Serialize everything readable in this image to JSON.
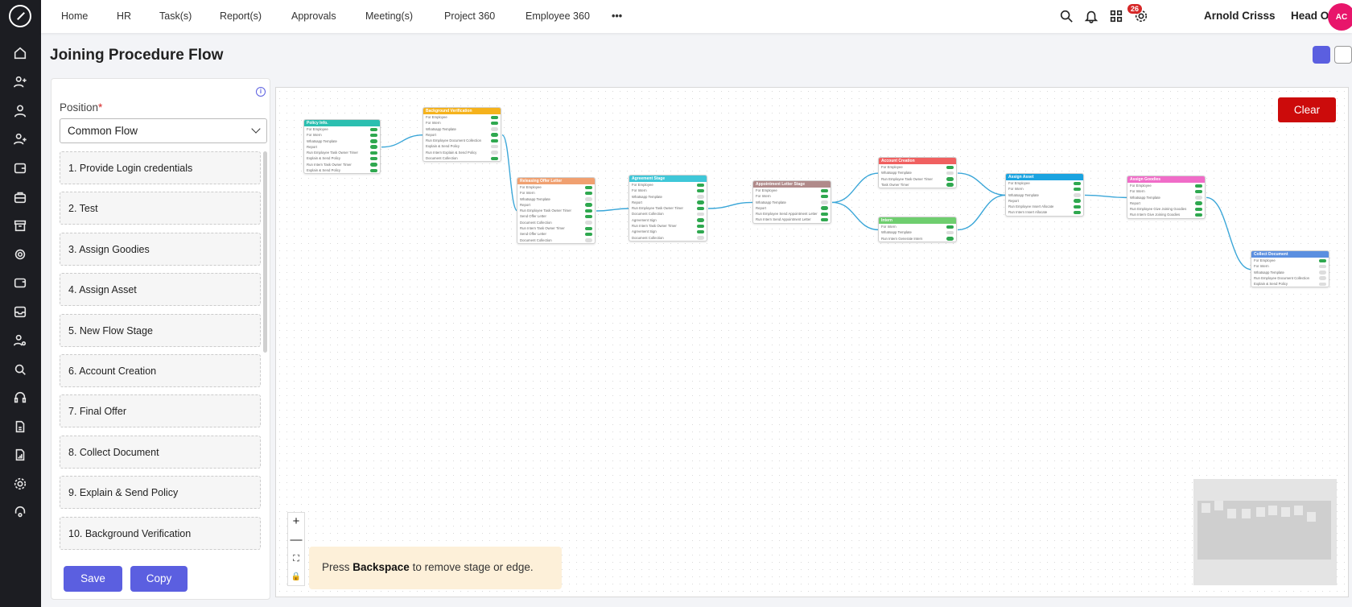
{
  "app": {
    "title": "Joining Procedure Flow"
  },
  "nav": [
    "Home",
    "HR",
    "Task(s)",
    "Report(s)",
    "Approvals",
    "Meeting(s)",
    "Project 360",
    "Employee 360",
    "•••"
  ],
  "header": {
    "notifications_count": "26",
    "user_name": "Arnold Crisss",
    "office": "Head Office",
    "avatar_initials": "AC"
  },
  "position": {
    "label": "Position",
    "required_mark": "*",
    "selected": "Common Flow"
  },
  "stages": [
    "1. Provide Login credentials",
    "2. Test",
    "3. Assign Goodies",
    "4. Assign Asset",
    "5. New Flow Stage",
    "6. Account Creation",
    "7. Final Offer",
    "8. Collect Document",
    "9. Explain & Send Policy",
    "10. Background Verification"
  ],
  "buttons": {
    "save": "Save",
    "copy": "Copy",
    "clear": "Clear"
  },
  "zoom": {
    "in": "+",
    "out": "—",
    "fit": "⛶",
    "lock": "🔒"
  },
  "hint": {
    "prefix": "Press ",
    "key": "Backspace",
    "suffix": " to remove stage or edge."
  },
  "colors": {
    "accent": "#5b5fe0",
    "danger": "#cc0b0b",
    "toggle_on": "#2fa84f",
    "edge": "#3aa6d8"
  },
  "flow_nodes": [
    {
      "id": "policy",
      "title": "Policy Info.",
      "color": "#2bbfb0",
      "rows": [
        [
          "For Employee",
          1
        ],
        [
          "For Intern",
          1
        ],
        [
          "Whatsapp Template",
          1
        ],
        [
          "Report",
          1
        ],
        [
          "Run Employee Task Owner Timer",
          1
        ],
        [
          "Explain & Send Policy",
          1
        ],
        [
          "Run Intern Task Owner Timer",
          1
        ],
        [
          "Explain & Send Policy",
          1
        ]
      ]
    },
    {
      "id": "bgv",
      "title": "Background Verification",
      "color": "#f5b21c",
      "rows": [
        [
          "For Employee",
          1
        ],
        [
          "For Intern",
          1
        ],
        [
          "Whatsapp Template",
          0
        ],
        [
          "Report",
          1
        ],
        [
          "Run Employee Document Collection",
          1
        ],
        [
          "Explain & Send Policy",
          0
        ],
        [
          "Run Intern Explain & Send Policy",
          0
        ],
        [
          "Document Collection",
          1
        ]
      ]
    },
    {
      "id": "offer",
      "title": "Releasing Offer Letter",
      "color": "#f0a070",
      "rows": [
        [
          "For Employee",
          1
        ],
        [
          "For Intern",
          1
        ],
        [
          "Whatsapp Template",
          0
        ],
        [
          "Report",
          1
        ],
        [
          "Run Employee Task Owner Timer",
          1
        ],
        [
          "Send Offer Letter",
          1
        ],
        [
          "Document Collection",
          0
        ],
        [
          "Run Intern Task Owner Timer",
          1
        ],
        [
          "Send Offer Letter",
          1
        ],
        [
          "Document Collection",
          0
        ]
      ]
    },
    {
      "id": "agreement",
      "title": "Agreement Stage",
      "color": "#3fc7d8",
      "rows": [
        [
          "For Employee",
          1
        ],
        [
          "For Intern",
          1
        ],
        [
          "Whatsapp Template",
          0
        ],
        [
          "Report",
          1
        ],
        [
          "Run Employee Task Owner Timer",
          1
        ],
        [
          "Document Collection",
          0
        ],
        [
          "Agreement Sign",
          1
        ],
        [
          "Run Intern Task Owner Timer",
          1
        ],
        [
          "Agreement Sign",
          1
        ],
        [
          "Document Collection",
          0
        ]
      ]
    },
    {
      "id": "appointment",
      "title": "Appointment Letter Stage",
      "color": "#b08a8a",
      "rows": [
        [
          "For Employee",
          1
        ],
        [
          "For Intern",
          1
        ],
        [
          "Whatsapp Template",
          0
        ],
        [
          "Report",
          1
        ],
        [
          "Run Employee Send Appointment Letter",
          1
        ],
        [
          "Run Intern Send Appointment Letter",
          1
        ]
      ]
    },
    {
      "id": "account",
      "title": "Account Creation",
      "color": "#f06060",
      "rows": [
        [
          "For Employee",
          1
        ],
        [
          "Whatsapp Template",
          0
        ],
        [
          "Run Employee Task Owner Timer",
          1
        ],
        [
          "Task Owner Timer",
          1
        ]
      ]
    },
    {
      "id": "intern",
      "title": "Intern",
      "color": "#6fce6f",
      "rows": [
        [
          "For Intern",
          1
        ],
        [
          "Whatsapp Template",
          0
        ],
        [
          "Run Intern Generate Intern",
          1
        ]
      ]
    },
    {
      "id": "asset",
      "title": "Assign Asset",
      "color": "#1aa3e0",
      "rows": [
        [
          "For Employee",
          1
        ],
        [
          "For Intern",
          1
        ],
        [
          "Whatsapp Template",
          0
        ],
        [
          "Report",
          1
        ],
        [
          "Run Employee Insert Allocate",
          1
        ],
        [
          "Run Intern Insert Allocate",
          1
        ]
      ]
    },
    {
      "id": "goodies",
      "title": "Assign Goodies",
      "color": "#f06cc8",
      "rows": [
        [
          "For Employee",
          1
        ],
        [
          "For Intern",
          1
        ],
        [
          "Whatsapp Template",
          0
        ],
        [
          "Report",
          1
        ],
        [
          "Run Employee Give Joining Goodies",
          1
        ],
        [
          "Run Intern Give Joining Goodies",
          1
        ]
      ]
    },
    {
      "id": "collect",
      "title": "Collect Document",
      "color": "#5b8fe0",
      "rows": [
        [
          "For Employee",
          1
        ],
        [
          "For Intern",
          0
        ],
        [
          "Whatsapp Template",
          0
        ],
        [
          "Run Employee Document Collection",
          0
        ],
        [
          "Explain & Send Policy",
          0
        ]
      ]
    }
  ]
}
